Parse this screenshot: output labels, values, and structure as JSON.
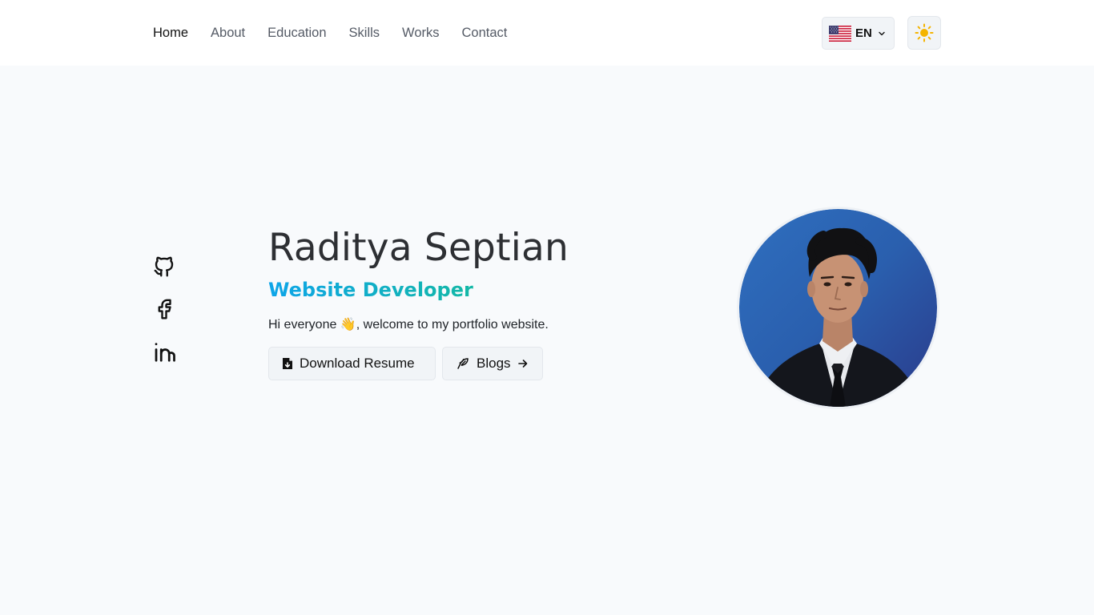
{
  "nav": {
    "items": [
      {
        "label": "Home",
        "active": true
      },
      {
        "label": "About",
        "active": false
      },
      {
        "label": "Education",
        "active": false
      },
      {
        "label": "Skills",
        "active": false
      },
      {
        "label": "Works",
        "active": false
      },
      {
        "label": "Contact",
        "active": false
      }
    ],
    "language": {
      "label": "EN",
      "flag_icon": "us-flag-icon",
      "chevron_icon": "chevron-down-icon"
    },
    "theme_toggle": {
      "icon": "sun-icon",
      "color": "#f4b400"
    }
  },
  "socials": [
    {
      "icon": "github-icon"
    },
    {
      "icon": "facebook-icon"
    },
    {
      "icon": "linkedin-icon"
    }
  ],
  "hero": {
    "name": "Raditya Septian",
    "role": "Website Developer",
    "greeting_prefix": "Hi everyone ",
    "greeting_emoji": "👋",
    "greeting_suffix": ", welcome to my portfolio website.",
    "buttons": [
      {
        "label": "Download Resume",
        "icon": "file-download-icon"
      },
      {
        "label": "Blogs",
        "icon": "feather-icon",
        "trailing_icon": "arrow-right-icon"
      }
    ],
    "role_gradient": [
      "#0ea5e9",
      "#14b8a6"
    ]
  }
}
